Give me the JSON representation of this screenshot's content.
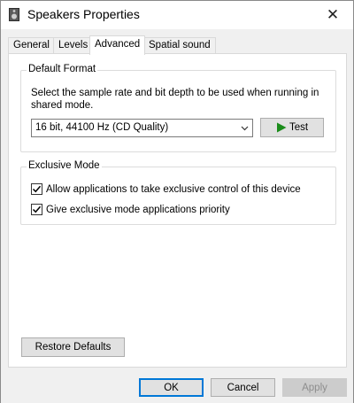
{
  "window": {
    "title": "Speakers Properties"
  },
  "titlebar": {
    "icon": "speaker-icon",
    "close_glyph": "✕"
  },
  "tabs": [
    {
      "label": "General",
      "active": false
    },
    {
      "label": "Levels",
      "active": false
    },
    {
      "label": "Advanced",
      "active": true
    },
    {
      "label": "Spatial sound",
      "active": false
    }
  ],
  "default_format": {
    "group_label": "Default Format",
    "description": "Select the sample rate and bit depth to be used when running in shared mode.",
    "selected_format": "16 bit, 44100 Hz (CD Quality)",
    "test_label": "Test"
  },
  "exclusive_mode": {
    "group_label": "Exclusive Mode",
    "options": [
      {
        "label": "Allow applications to take exclusive control of this device",
        "checked": true
      },
      {
        "label": "Give exclusive mode applications priority",
        "checked": true
      }
    ]
  },
  "restore_label": "Restore Defaults",
  "footer": {
    "ok": "OK",
    "cancel": "Cancel",
    "apply": "Apply"
  },
  "colors": {
    "accent": "#0078d7",
    "play": "#1a8c1a"
  }
}
